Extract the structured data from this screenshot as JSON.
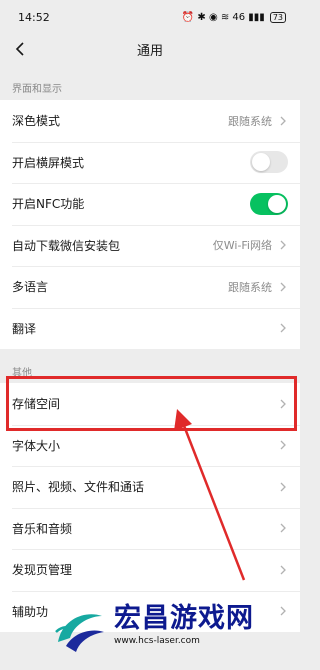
{
  "status_bar": {
    "time": "14:52",
    "icons": "⏰ ✱ ◉ ≋ 46 ▮▮▮",
    "battery": "73"
  },
  "header": {
    "title": "通用"
  },
  "sections": [
    {
      "label": "界面和显示",
      "rows": [
        {
          "label": "深色模式",
          "value": "跟随系统",
          "control": "chevron"
        },
        {
          "label": "开启横屏模式",
          "control": "toggle",
          "state": false
        },
        {
          "label": "开启NFC功能",
          "control": "toggle",
          "state": true
        },
        {
          "label": "自动下载微信安装包",
          "value": "仅Wi-Fi网络",
          "control": "chevron"
        },
        {
          "label": "多语言",
          "value": "跟随系统",
          "control": "chevron"
        },
        {
          "label": "翻译",
          "control": "chevron"
        }
      ]
    },
    {
      "label": "其他",
      "rows": [
        {
          "label": "存储空间",
          "control": "chevron"
        },
        {
          "label": "字体大小",
          "control": "chevron"
        },
        {
          "label": "照片、视频、文件和通话",
          "control": "chevron"
        },
        {
          "label": "音乐和音频",
          "control": "chevron"
        },
        {
          "label": "发现页管理",
          "control": "chevron"
        },
        {
          "label": "辅助功",
          "control": "chevron"
        }
      ]
    }
  ],
  "watermark": {
    "title": "宏昌游戏网",
    "url": "www.hcs-laser.com"
  },
  "colors": {
    "toggle_on": "#07c160",
    "highlight": "#e02a2a",
    "watermark_text": "#0d1a8f"
  }
}
